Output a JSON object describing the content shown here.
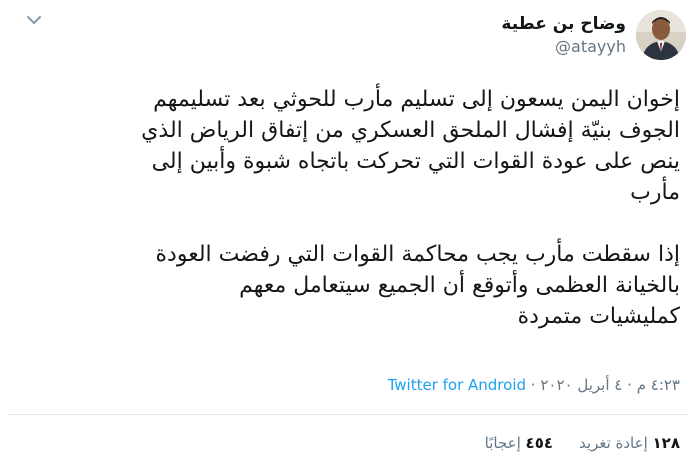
{
  "author": {
    "display_name": "وضاح بن عطية",
    "handle": "@atayyh",
    "avatar_icon": "profile-photo"
  },
  "tweet": {
    "paragraph_1": "إخوان اليمن يسعون إلى تسليم مأرب للحوثي بعد تسليمهم\nالجوف بنيّة إفشال الملحق العسكري من إتفاق الرياض الذي\nينص على عودة القوات التي تحركت باتجاه شبوة وأبين إلى\nمأرب",
    "paragraph_2": "إذا سقطت مأرب يجب محاكمة القوات التي رفضت العودة\nبالخيانة العظمى وأتوقع أن الجميع سيتعامل معهم\nكمليشيات متمردة"
  },
  "meta": {
    "time": "٤:٢٣ م",
    "separator": "·",
    "date": "٤ أبريل ٢٠٢٠",
    "source": "Twitter for Android"
  },
  "stats": {
    "retweets_count": "١٢٨",
    "retweets_label": "إعادة تغريد",
    "likes_count": "٤٥٤",
    "likes_label": "إعجابًا"
  },
  "colors": {
    "link": "#1da1f2",
    "secondary_text": "#657786",
    "primary_text": "#14171a",
    "divider": "#e1e8ed"
  }
}
